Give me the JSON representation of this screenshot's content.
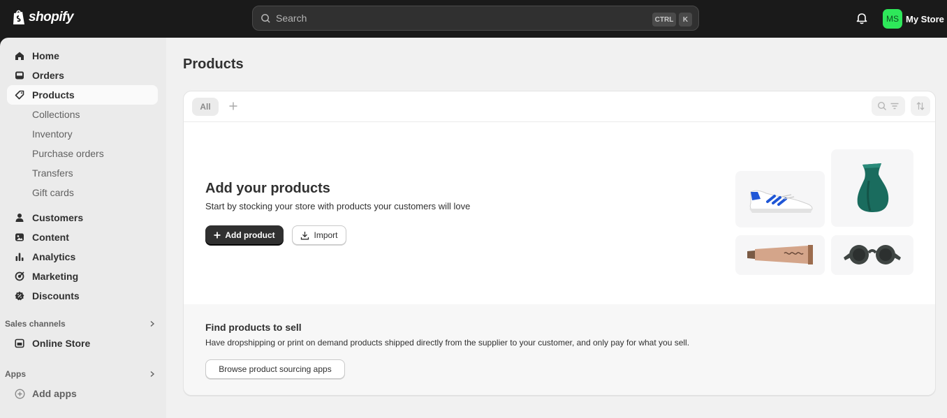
{
  "topbar": {
    "brand": "shopify",
    "search_placeholder": "Search",
    "shortcut_ctrl": "CTRL",
    "shortcut_key": "K",
    "store_initials": "MS",
    "store_name": "My Store"
  },
  "sidebar": {
    "items": [
      {
        "label": "Home",
        "icon": "home-icon"
      },
      {
        "label": "Orders",
        "icon": "inbox-icon"
      },
      {
        "label": "Products",
        "icon": "tag-icon",
        "active": true
      },
      {
        "label": "Collections"
      },
      {
        "label": "Inventory"
      },
      {
        "label": "Purchase orders"
      },
      {
        "label": "Transfers"
      },
      {
        "label": "Gift cards"
      },
      {
        "label": "Customers",
        "icon": "person-icon"
      },
      {
        "label": "Content",
        "icon": "content-icon"
      },
      {
        "label": "Analytics",
        "icon": "bar-chart-icon"
      },
      {
        "label": "Marketing",
        "icon": "target-icon"
      },
      {
        "label": "Discounts",
        "icon": "discount-icon"
      }
    ],
    "sales_channels_label": "Sales channels",
    "online_store_label": "Online Store",
    "apps_label": "Apps",
    "add_apps_label": "Add apps"
  },
  "main": {
    "title": "Products",
    "tab_all": "All",
    "empty_state": {
      "title": "Add your products",
      "subtitle": "Start by stocking your store with products your customers will love",
      "add_button": "Add product",
      "import_button": "Import"
    },
    "sourcing": {
      "title": "Find products to sell",
      "subtitle": "Have dropshipping or print on demand products shipped directly from the supplier to your customer, and only pay for what you sell.",
      "button": "Browse product sourcing apps"
    }
  },
  "colors": {
    "topbar_bg": "#1a1a1a",
    "sidebar_bg": "#ebebeb",
    "main_bg": "#f1f1f1",
    "avatar_green": "#2ee85a",
    "primary_button": "#303030"
  }
}
